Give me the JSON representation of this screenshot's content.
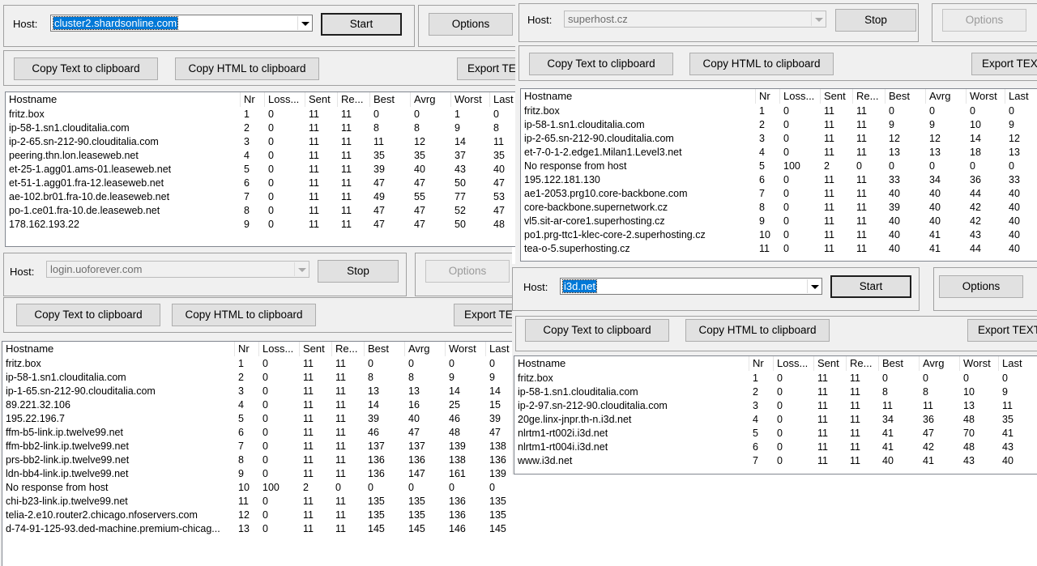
{
  "common": {
    "host_label": "Host:",
    "options_label": "Options",
    "copy_text_label": "Copy Text to clipboard",
    "copy_html_label": "Copy HTML to clipboard",
    "export_label": "Export TEXT",
    "columns": [
      "Hostname",
      "Nr",
      "Loss...",
      "Sent",
      "Re...",
      "Best",
      "Avrg",
      "Worst",
      "Last"
    ]
  },
  "panes": [
    {
      "host": "cluster2.shardsonline.com",
      "action_label": "Start",
      "state": "idle",
      "rows": [
        [
          "fritz.box",
          "1",
          "0",
          "11",
          "11",
          "0",
          "0",
          "1",
          "0"
        ],
        [
          "ip-58-1.sn1.clouditalia.com",
          "2",
          "0",
          "11",
          "11",
          "8",
          "8",
          "9",
          "8"
        ],
        [
          "ip-2-65.sn-212-90.clouditalia.com",
          "3",
          "0",
          "11",
          "11",
          "11",
          "12",
          "14",
          "11"
        ],
        [
          "peering.thn.lon.leaseweb.net",
          "4",
          "0",
          "11",
          "11",
          "35",
          "35",
          "37",
          "35"
        ],
        [
          "et-25-1.agg01.ams-01.leaseweb.net",
          "5",
          "0",
          "11",
          "11",
          "39",
          "40",
          "43",
          "40"
        ],
        [
          "et-51-1.agg01.fra-12.leaseweb.net",
          "6",
          "0",
          "11",
          "11",
          "47",
          "47",
          "50",
          "47"
        ],
        [
          "ae-102.br01.fra-10.de.leaseweb.net",
          "7",
          "0",
          "11",
          "11",
          "49",
          "55",
          "77",
          "53"
        ],
        [
          "po-1.ce01.fra-10.de.leaseweb.net",
          "8",
          "0",
          "11",
          "11",
          "47",
          "47",
          "52",
          "47"
        ],
        [
          "178.162.193.22",
          "9",
          "0",
          "11",
          "11",
          "47",
          "47",
          "50",
          "48"
        ]
      ]
    },
    {
      "host": "login.uoforever.com",
      "action_label": "Stop",
      "state": "running",
      "rows": [
        [
          "fritz.box",
          "1",
          "0",
          "11",
          "11",
          "0",
          "0",
          "0",
          "0"
        ],
        [
          "ip-58-1.sn1.clouditalia.com",
          "2",
          "0",
          "11",
          "11",
          "8",
          "8",
          "9",
          "9"
        ],
        [
          "ip-1-65.sn-212-90.clouditalia.com",
          "3",
          "0",
          "11",
          "11",
          "13",
          "13",
          "14",
          "14"
        ],
        [
          "89.221.32.106",
          "4",
          "0",
          "11",
          "11",
          "14",
          "16",
          "25",
          "15"
        ],
        [
          "195.22.196.7",
          "5",
          "0",
          "11",
          "11",
          "39",
          "40",
          "46",
          "39"
        ],
        [
          "ffm-b5-link.ip.twelve99.net",
          "6",
          "0",
          "11",
          "11",
          "46",
          "47",
          "48",
          "47"
        ],
        [
          "ffm-bb2-link.ip.twelve99.net",
          "7",
          "0",
          "11",
          "11",
          "137",
          "137",
          "139",
          "138"
        ],
        [
          "prs-bb2-link.ip.twelve99.net",
          "8",
          "0",
          "11",
          "11",
          "136",
          "136",
          "138",
          "136"
        ],
        [
          "ldn-bb4-link.ip.twelve99.net",
          "9",
          "0",
          "11",
          "11",
          "136",
          "147",
          "161",
          "139"
        ],
        [
          "No response from host",
          "10",
          "100",
          "2",
          "0",
          "0",
          "0",
          "0",
          "0"
        ],
        [
          "chi-b23-link.ip.twelve99.net",
          "11",
          "0",
          "11",
          "11",
          "135",
          "135",
          "136",
          "135"
        ],
        [
          "telia-2.e10.router2.chicago.nfoservers.com",
          "12",
          "0",
          "11",
          "11",
          "135",
          "135",
          "136",
          "135"
        ],
        [
          "d-74-91-125-93.ded-machine.premium-chicag...",
          "13",
          "0",
          "11",
          "11",
          "145",
          "145",
          "146",
          "145"
        ]
      ]
    },
    {
      "host": "superhost.cz",
      "action_label": "Stop",
      "state": "running",
      "rows": [
        [
          "fritz.box",
          "1",
          "0",
          "11",
          "11",
          "0",
          "0",
          "0",
          "0"
        ],
        [
          "ip-58-1.sn1.clouditalia.com",
          "2",
          "0",
          "11",
          "11",
          "9",
          "9",
          "10",
          "9"
        ],
        [
          "ip-2-65.sn-212-90.clouditalia.com",
          "3",
          "0",
          "11",
          "11",
          "12",
          "12",
          "14",
          "12"
        ],
        [
          "et-7-0-1-2.edge1.Milan1.Level3.net",
          "4",
          "0",
          "11",
          "11",
          "13",
          "13",
          "18",
          "13"
        ],
        [
          "No response from host",
          "5",
          "100",
          "2",
          "0",
          "0",
          "0",
          "0",
          "0"
        ],
        [
          "195.122.181.130",
          "6",
          "0",
          "11",
          "11",
          "33",
          "34",
          "36",
          "33"
        ],
        [
          "ae1-2053.prg10.core-backbone.com",
          "7",
          "0",
          "11",
          "11",
          "40",
          "40",
          "44",
          "40"
        ],
        [
          "core-backbone.supernetwork.cz",
          "8",
          "0",
          "11",
          "11",
          "39",
          "40",
          "42",
          "40"
        ],
        [
          "vl5.sit-ar-core1.superhosting.cz",
          "9",
          "0",
          "11",
          "11",
          "40",
          "40",
          "42",
          "40"
        ],
        [
          "po1.prg-ttc1-klec-core-2.superhosting.cz",
          "10",
          "0",
          "11",
          "11",
          "40",
          "41",
          "43",
          "40"
        ],
        [
          "tea-o-5.superhosting.cz",
          "11",
          "0",
          "11",
          "11",
          "40",
          "41",
          "44",
          "40"
        ]
      ]
    },
    {
      "host": "i3d.net",
      "action_label": "Start",
      "state": "idle",
      "rows": [
        [
          "fritz.box",
          "1",
          "0",
          "11",
          "11",
          "0",
          "0",
          "0",
          "0"
        ],
        [
          "ip-58-1.sn1.clouditalia.com",
          "2",
          "0",
          "11",
          "11",
          "8",
          "8",
          "10",
          "9"
        ],
        [
          "ip-2-97.sn-212-90.clouditalia.com",
          "3",
          "0",
          "11",
          "11",
          "11",
          "11",
          "13",
          "11"
        ],
        [
          "20ge.linx-jnpr.th-n.i3d.net",
          "4",
          "0",
          "11",
          "11",
          "34",
          "36",
          "48",
          "35"
        ],
        [
          "nlrtm1-rt002i.i3d.net",
          "5",
          "0",
          "11",
          "11",
          "41",
          "47",
          "70",
          "41"
        ],
        [
          "nlrtm1-rt004i.i3d.net",
          "6",
          "0",
          "11",
          "11",
          "41",
          "42",
          "48",
          "43"
        ],
        [
          "www.i3d.net",
          "7",
          "0",
          "11",
          "11",
          "40",
          "41",
          "43",
          "40"
        ]
      ]
    }
  ]
}
